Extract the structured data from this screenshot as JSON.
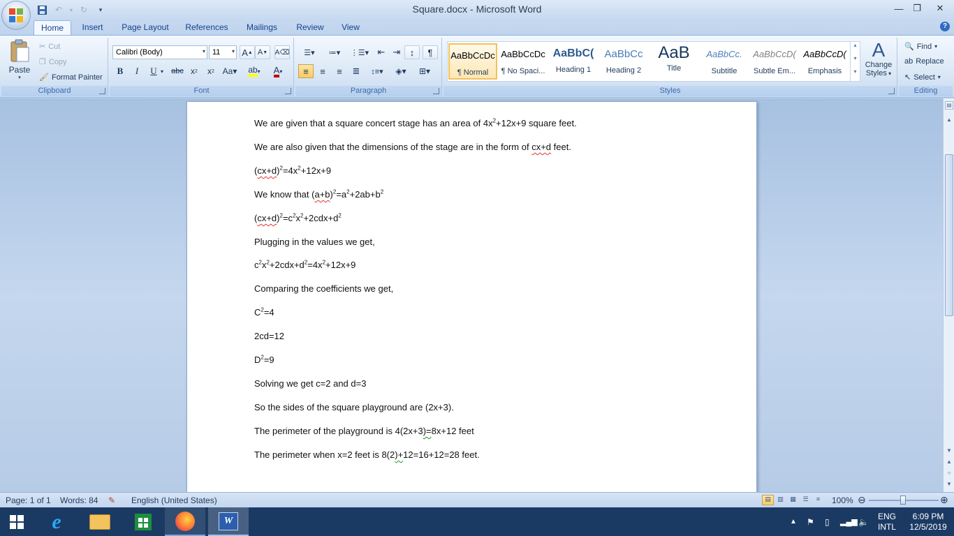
{
  "window": {
    "title": "Square.docx - Microsoft Word"
  },
  "qat": {
    "save_icon": "save-icon",
    "undo_icon": "undo-icon",
    "redo_icon": "redo-icon",
    "customize_icon": "chevron-down-icon"
  },
  "tabs": [
    {
      "label": "Home",
      "active": true
    },
    {
      "label": "Insert"
    },
    {
      "label": "Page Layout"
    },
    {
      "label": "References"
    },
    {
      "label": "Mailings"
    },
    {
      "label": "Review"
    },
    {
      "label": "View"
    }
  ],
  "clipboard": {
    "group": "Clipboard",
    "paste": "Paste",
    "cut": "Cut",
    "copy": "Copy",
    "format_painter": "Format Painter"
  },
  "font": {
    "group": "Font",
    "family": "Calibri (Body)",
    "size": "11"
  },
  "paragraph": {
    "group": "Paragraph"
  },
  "styles": {
    "group": "Styles",
    "items": [
      {
        "preview": "AaBbCcDc",
        "name": "¶ Normal",
        "selected": true
      },
      {
        "preview": "AaBbCcDc",
        "name": "¶ No Spaci..."
      },
      {
        "preview": "AaBbC(",
        "name": "Heading 1"
      },
      {
        "preview": "AaBbCc",
        "name": "Heading 2"
      },
      {
        "preview": "AaB",
        "name": "Title"
      },
      {
        "preview": "AaBbCc.",
        "name": "Subtitle"
      },
      {
        "preview": "AaBbCcD(",
        "name": "Subtle Em..."
      },
      {
        "preview": "AaBbCcD(",
        "name": "Emphasis"
      }
    ],
    "change_styles_line1": "Change",
    "change_styles_line2": "Styles"
  },
  "editing": {
    "group": "Editing",
    "find": "Find",
    "replace": "Replace",
    "select": "Select"
  },
  "status": {
    "page": "Page: 1 of 1",
    "words": "Words: 84",
    "language": "English (United States)",
    "zoom": "100%"
  },
  "taskbar": {
    "lang_top": "ENG",
    "lang_bottom": "INTL",
    "time": "6:09 PM",
    "date": "12/5/2019"
  },
  "colors": {
    "font_color": "#c00000",
    "highlight": "#ffff00",
    "accent": "#15428b"
  }
}
